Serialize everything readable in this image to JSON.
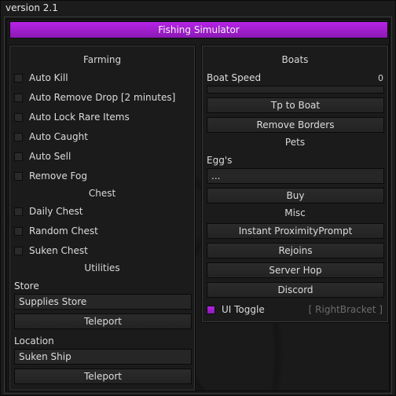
{
  "window": {
    "version": "version 2.1",
    "title": "Fishing Simulator",
    "accent": "#a01fd0"
  },
  "left": {
    "farming": {
      "title": "Farming",
      "toggles": [
        {
          "label": "Auto Kill",
          "checked": false
        },
        {
          "label": "Auto Remove Drop [2 minutes]",
          "checked": false
        },
        {
          "label": "Auto Lock Rare Items",
          "checked": false
        },
        {
          "label": "Auto Caught",
          "checked": false
        },
        {
          "label": "Auto Sell",
          "checked": false
        },
        {
          "label": "Remove Fog",
          "checked": false
        }
      ]
    },
    "chest": {
      "title": "Chest",
      "toggles": [
        {
          "label": "Daily Chest",
          "checked": false
        },
        {
          "label": "Random Chest",
          "checked": false
        },
        {
          "label": "Suken Chest",
          "checked": false
        }
      ]
    },
    "utilities": {
      "title": "Utilities",
      "store_label": "Store",
      "store_value": "Supplies Store",
      "store_teleport": "Teleport",
      "location_label": "Location",
      "location_value": "Suken Ship",
      "location_teleport": "Teleport"
    }
  },
  "right": {
    "boats": {
      "title": "Boats",
      "speed_label": "Boat Speed",
      "speed_value": "0",
      "speed_fraction": 0,
      "tp_button": "Tp to Boat",
      "remove_borders_button": "Remove Borders"
    },
    "pets": {
      "title": "Pets",
      "eggs_label": "Egg's",
      "eggs_value": "...",
      "buy_button": "Buy"
    },
    "misc": {
      "title": "Misc",
      "buttons": [
        "Instant ProximityPrompt",
        "Rejoins",
        "Server Hop",
        "Discord"
      ],
      "ui_toggle_label": "UI Toggle",
      "ui_toggle_checked": true,
      "ui_toggle_key": "[ RightBracket ]"
    }
  }
}
